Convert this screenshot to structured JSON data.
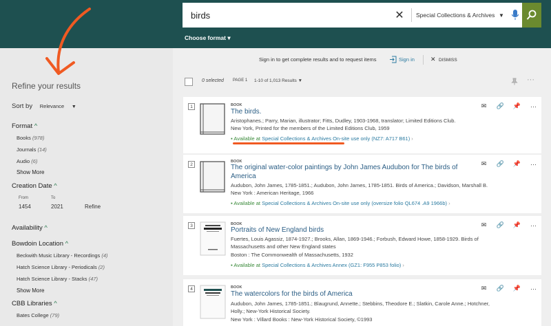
{
  "search": {
    "query": "birds",
    "scope": "Special Collections & Archives"
  },
  "choose_format": "Choose format",
  "signin_bar": {
    "message": "Sign in to get complete results and to request items",
    "signin": "Sign in",
    "dismiss": "DISMISS"
  },
  "results_header": {
    "selected": "0 selected",
    "page": "PAGE 1",
    "range": "1-10 of 1,013 Results"
  },
  "sidebar": {
    "title": "Refine your results",
    "sort_label": "Sort by",
    "sort_value": "Relevance",
    "format": {
      "heading": "Format",
      "items": [
        {
          "label": "Books",
          "count": "(978)"
        },
        {
          "label": "Journals",
          "count": "(14)"
        },
        {
          "label": "Audio",
          "count": "(6)"
        }
      ],
      "more": "Show More"
    },
    "creation": {
      "heading": "Creation Date",
      "from_label": "From",
      "to_label": "To",
      "from": "1454",
      "to": "2021",
      "refine": "Refine"
    },
    "availability": {
      "heading": "Availability"
    },
    "location": {
      "heading": "Bowdoin Location",
      "items": [
        {
          "label": "Beckwith Music Library - Recordings",
          "count": "(4)"
        },
        {
          "label": "Hatch Science Library - Periodicals",
          "count": "(2)"
        },
        {
          "label": "Hatch Science Library - Stacks",
          "count": "(47)"
        }
      ],
      "more": "Show More"
    },
    "cbb": {
      "heading": "CBB Libraries",
      "items": [
        {
          "label": "Bates College",
          "count": "(79)"
        }
      ]
    }
  },
  "results": [
    {
      "num": "1",
      "type": "BOOK",
      "title": "The birds.",
      "lines": [
        "Aristophanes.; Parry, Marian, illustrator; Fitts, Dudley, 1903-1968, translator; Limited Editions Club.",
        "New York, Printed for the members of the Limited Editions Club, 1959"
      ],
      "avail": "Available at",
      "avail_loc": "Special Collections & Archives",
      "avail_note": "On-site use only (NZ7: A717 B61)"
    },
    {
      "num": "2",
      "type": "BOOK",
      "title": "The original water-color paintings by John James Audubon for The birds of America",
      "lines": [
        "Audubon, John James, 1785-1851.; Audubon, John James, 1785-1851. Birds of America.; Davidson, Marshall B.",
        "New York : American Heritage, 1966"
      ],
      "avail": "Available at",
      "avail_loc": "Special Collections & Archives",
      "avail_note": "On-site use only (oversize folio QL674 .A9 1966b)"
    },
    {
      "num": "3",
      "type": "BOOK",
      "title": "Portraits of New England birds",
      "lines": [
        "Fuertes, Louis Agassiz, 1874-1927.; Brooks, Allan, 1869-1946.; Forbush, Edward Howe, 1858-1929. Birds of",
        "Massachusetts and other New England states",
        "Boston : The Commonwealth of Massachusetts, 1932"
      ],
      "avail": "Available at",
      "avail_loc": "Special Collections & Archives",
      "avail_note": "Annex (GZ1: F955 P853 folio)"
    },
    {
      "num": "4",
      "type": "BOOK",
      "title": "The watercolors for the birds of America",
      "lines": [
        "Audubon, John James, 1785-1851.; Blaugrund, Annette.; Stebbins, Theodore E.; Slatkin, Carole Anne.; Hotchner,",
        "Holly.; New-York Historical Society.",
        "New York : Villard Books : New-York Historical Society, ©1993"
      ]
    }
  ],
  "colors": {
    "header": "#1e5050",
    "accent": "#2a7a4f",
    "go": "#6b8a2f",
    "annotation": "#f05a22"
  },
  "icons": [
    "close-icon",
    "mic-icon",
    "search-icon",
    "signin-icon",
    "pin-icon",
    "more-icon",
    "email-icon",
    "link-icon",
    "book-icon"
  ]
}
